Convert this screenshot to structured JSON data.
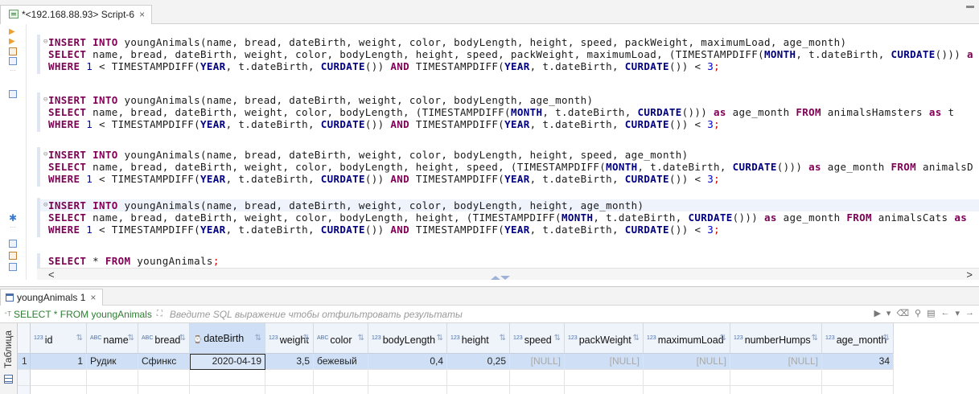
{
  "editor_tab": {
    "label": "*<192.168.88.93> Script-6",
    "close": "×"
  },
  "code": {
    "statements": [
      {
        "lines": [
          [
            [
              "kw",
              "INSERT "
            ],
            [
              "kw",
              "INTO "
            ],
            [
              "t",
              "youngAnimals(name, bread, dateBirth, weight, color, bodyLength, height, speed, packWeight, maximumLoad, age_month)"
            ]
          ],
          [
            [
              "kw",
              "SELECT "
            ],
            [
              "t",
              "name, bread, dateBirth, weight, color, bodyLength, height, speed, packWeight, maximumLoad, (TIMESTAMPDIFF("
            ],
            [
              "cons",
              "MONTH"
            ],
            [
              "t",
              ", t.dateBirth, "
            ],
            [
              "cons",
              "CURDATE"
            ],
            [
              "t",
              "())) "
            ],
            [
              "kw",
              "a"
            ]
          ],
          [
            [
              "kw",
              "WHERE "
            ],
            [
              "num",
              "1"
            ],
            [
              "t",
              " < TIMESTAMPDIFF("
            ],
            [
              "cons",
              "YEAR"
            ],
            [
              "t",
              ", t.dateBirth, "
            ],
            [
              "cons",
              "CURDATE"
            ],
            [
              "t",
              "()) "
            ],
            [
              "kw",
              "AND "
            ],
            [
              "t",
              "TIMESTAMPDIFF("
            ],
            [
              "cons",
              "YEAR"
            ],
            [
              "t",
              ", t.dateBirth, "
            ],
            [
              "cons",
              "CURDATE"
            ],
            [
              "t",
              "()) < "
            ],
            [
              "num",
              "3"
            ],
            [
              "semi",
              ";"
            ]
          ]
        ]
      },
      {
        "lines": [
          [
            [
              "kw",
              "INSERT "
            ],
            [
              "kw",
              "INTO "
            ],
            [
              "t",
              "youngAnimals(name, bread, dateBirth, weight, color, bodyLength, age_month)"
            ]
          ],
          [
            [
              "kw",
              "SELECT "
            ],
            [
              "t",
              "name, bread, dateBirth, weight, color, bodyLength, (TIMESTAMPDIFF("
            ],
            [
              "cons",
              "MONTH"
            ],
            [
              "t",
              ", t.dateBirth, "
            ],
            [
              "cons",
              "CURDATE"
            ],
            [
              "t",
              "())) "
            ],
            [
              "kw",
              "as "
            ],
            [
              "t",
              "age_month "
            ],
            [
              "kw",
              "FROM "
            ],
            [
              "t",
              "animalsHamsters "
            ],
            [
              "kw",
              "as "
            ],
            [
              "t",
              "t"
            ]
          ],
          [
            [
              "kw",
              "WHERE "
            ],
            [
              "num",
              "1"
            ],
            [
              "t",
              " < TIMESTAMPDIFF("
            ],
            [
              "cons",
              "YEAR"
            ],
            [
              "t",
              ", t.dateBirth, "
            ],
            [
              "cons",
              "CURDATE"
            ],
            [
              "t",
              "()) "
            ],
            [
              "kw",
              "AND "
            ],
            [
              "t",
              "TIMESTAMPDIFF("
            ],
            [
              "cons",
              "YEAR"
            ],
            [
              "t",
              ", t.dateBirth, "
            ],
            [
              "cons",
              "CURDATE"
            ],
            [
              "t",
              "()) < "
            ],
            [
              "num",
              "3"
            ],
            [
              "semi",
              ";"
            ]
          ]
        ]
      },
      {
        "lines": [
          [
            [
              "kw",
              "INSERT "
            ],
            [
              "kw",
              "INTO "
            ],
            [
              "t",
              "youngAnimals(name, bread, dateBirth, weight, color, bodyLength, height, speed, age_month)"
            ]
          ],
          [
            [
              "kw",
              "SELECT "
            ],
            [
              "t",
              "name, bread, dateBirth, weight, color, bodyLength, height, speed, (TIMESTAMPDIFF("
            ],
            [
              "cons",
              "MONTH"
            ],
            [
              "t",
              ", t.dateBirth, "
            ],
            [
              "cons",
              "CURDATE"
            ],
            [
              "t",
              "())) "
            ],
            [
              "kw",
              "as "
            ],
            [
              "t",
              "age_month "
            ],
            [
              "kw",
              "FROM "
            ],
            [
              "t",
              "animalsD"
            ]
          ],
          [
            [
              "kw",
              "WHERE "
            ],
            [
              "num",
              "1"
            ],
            [
              "t",
              " < TIMESTAMPDIFF("
            ],
            [
              "cons",
              "YEAR"
            ],
            [
              "t",
              ", t.dateBirth, "
            ],
            [
              "cons",
              "CURDATE"
            ],
            [
              "t",
              "()) "
            ],
            [
              "kw",
              "AND "
            ],
            [
              "t",
              "TIMESTAMPDIFF("
            ],
            [
              "cons",
              "YEAR"
            ],
            [
              "t",
              ", t.dateBirth, "
            ],
            [
              "cons",
              "CURDATE"
            ],
            [
              "t",
              "()) < "
            ],
            [
              "num",
              "3"
            ],
            [
              "semi",
              ";"
            ]
          ]
        ]
      },
      {
        "lines": [
          [
            [
              "kw",
              "INSERT "
            ],
            [
              "kw",
              "INTO "
            ],
            [
              "t",
              "youngAnimals(name, bread, dateBirth, weight, color, bodyLength, height, age_month)"
            ]
          ],
          [
            [
              "kw",
              "SELECT "
            ],
            [
              "t",
              "name, bread, dateBirth, weight, color, bodyLength, height, (TIMESTAMPDIFF("
            ],
            [
              "cons",
              "MONTH"
            ],
            [
              "t",
              ", t.dateBirth, "
            ],
            [
              "cons",
              "CURDATE"
            ],
            [
              "t",
              "())) "
            ],
            [
              "kw",
              "as "
            ],
            [
              "t",
              "age_month "
            ],
            [
              "kw",
              "FROM "
            ],
            [
              "t",
              "animalsCats "
            ],
            [
              "kw",
              "as"
            ]
          ],
          [
            [
              "kw",
              "WHERE "
            ],
            [
              "num",
              "1"
            ],
            [
              "t",
              " < TIMESTAMPDIFF("
            ],
            [
              "cons",
              "YEAR"
            ],
            [
              "t",
              ", t.dateBirth, "
            ],
            [
              "cons",
              "CURDATE"
            ],
            [
              "t",
              "()) "
            ],
            [
              "kw",
              "AND "
            ],
            [
              "t",
              "TIMESTAMPDIFF("
            ],
            [
              "cons",
              "YEAR"
            ],
            [
              "t",
              ", t.dateBirth, "
            ],
            [
              "cons",
              "CURDATE"
            ],
            [
              "t",
              "()) < "
            ],
            [
              "num",
              "3"
            ],
            [
              "semi",
              ";"
            ]
          ]
        ]
      },
      {
        "lines": [
          [
            [
              "kw",
              "SELECT "
            ],
            [
              "t",
              "* "
            ],
            [
              "kw",
              "FROM "
            ],
            [
              "t",
              "youngAnimals"
            ],
            [
              "semi",
              ";"
            ]
          ]
        ]
      }
    ],
    "scroll_left": "<",
    "scroll_right": ">"
  },
  "results": {
    "tab_label": "youngAnimals 1",
    "tab_close": "×",
    "filter_sql": "SELECT * FROM youngAnimals",
    "filter_placeholder": "Введите SQL выражение чтобы отфильтровать результаты",
    "side_tab": "Таблица",
    "columns": [
      {
        "type": "123",
        "name": "id"
      },
      {
        "type": "ABC",
        "name": "name"
      },
      {
        "type": "ABC",
        "name": "bread"
      },
      {
        "type": "date",
        "name": "dateBirth"
      },
      {
        "type": "123",
        "name": "weight"
      },
      {
        "type": "ABC",
        "name": "color"
      },
      {
        "type": "123",
        "name": "bodyLength"
      },
      {
        "type": "123",
        "name": "height"
      },
      {
        "type": "123",
        "name": "speed"
      },
      {
        "type": "123",
        "name": "packWeight"
      },
      {
        "type": "123",
        "name": "maximumLoad"
      },
      {
        "type": "123",
        "name": "numberHumps"
      },
      {
        "type": "123",
        "name": "age_month"
      }
    ],
    "rows": [
      {
        "num": "1",
        "cells": [
          "1",
          "Рудик",
          "Сфинкс",
          "2020-04-19",
          "3,5",
          "бежевый",
          "0,4",
          "0,25",
          "[NULL]",
          "[NULL]",
          "[NULL]",
          "[NULL]",
          "34"
        ]
      }
    ]
  }
}
